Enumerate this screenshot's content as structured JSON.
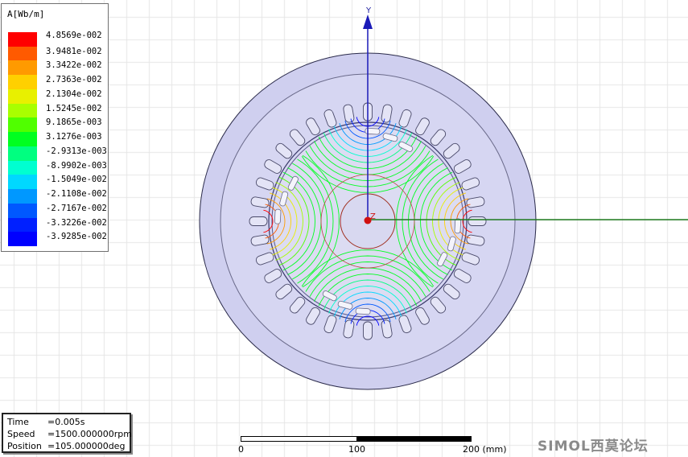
{
  "legend": {
    "title": "A[Wb/m]",
    "entries": [
      {
        "value": "4.8569e-002",
        "color": "#ff0000"
      },
      {
        "value": "3.9481e-002",
        "color": "#ff5a00"
      },
      {
        "value": "3.3422e-002",
        "color": "#ff9a00"
      },
      {
        "value": "2.7363e-002",
        "color": "#ffd000"
      },
      {
        "value": "2.1304e-002",
        "color": "#e8f000"
      },
      {
        "value": "1.5245e-002",
        "color": "#a8ff00"
      },
      {
        "value": "9.1865e-003",
        "color": "#50ff00"
      },
      {
        "value": "3.1276e-003",
        "color": "#00ff20"
      },
      {
        "value": "-2.9313e-003",
        "color": "#00ff80"
      },
      {
        "value": "-8.9902e-003",
        "color": "#00ffd0"
      },
      {
        "value": "-1.5049e-002",
        "color": "#00d8ff"
      },
      {
        "value": "-2.1108e-002",
        "color": "#0098ff"
      },
      {
        "value": "-2.7167e-002",
        "color": "#0058ff"
      },
      {
        "value": "-3.3226e-002",
        "color": "#0020ff"
      },
      {
        "value": "-3.9285e-002",
        "color": "#0000ff"
      }
    ]
  },
  "info": {
    "time_label": "Time",
    "time_value": "=0.005s",
    "speed_label": "Speed",
    "speed_value": "=1500.000000rpm",
    "position_label": "Position",
    "position_value": "=105.000000deg"
  },
  "scale": {
    "tick0": "0",
    "tick1": "100",
    "tick2": "200 (mm)"
  },
  "axes": {
    "y_label": "Y",
    "z_label": "Z"
  },
  "watermark": "SIMOL西莫论坛",
  "colors": {
    "stator": "#cfcfef",
    "rotor": "#d8d8f0",
    "outline": "#2a2a4a",
    "y_axis": "#1a1ab8",
    "x_axis": "#1f7a1f"
  }
}
